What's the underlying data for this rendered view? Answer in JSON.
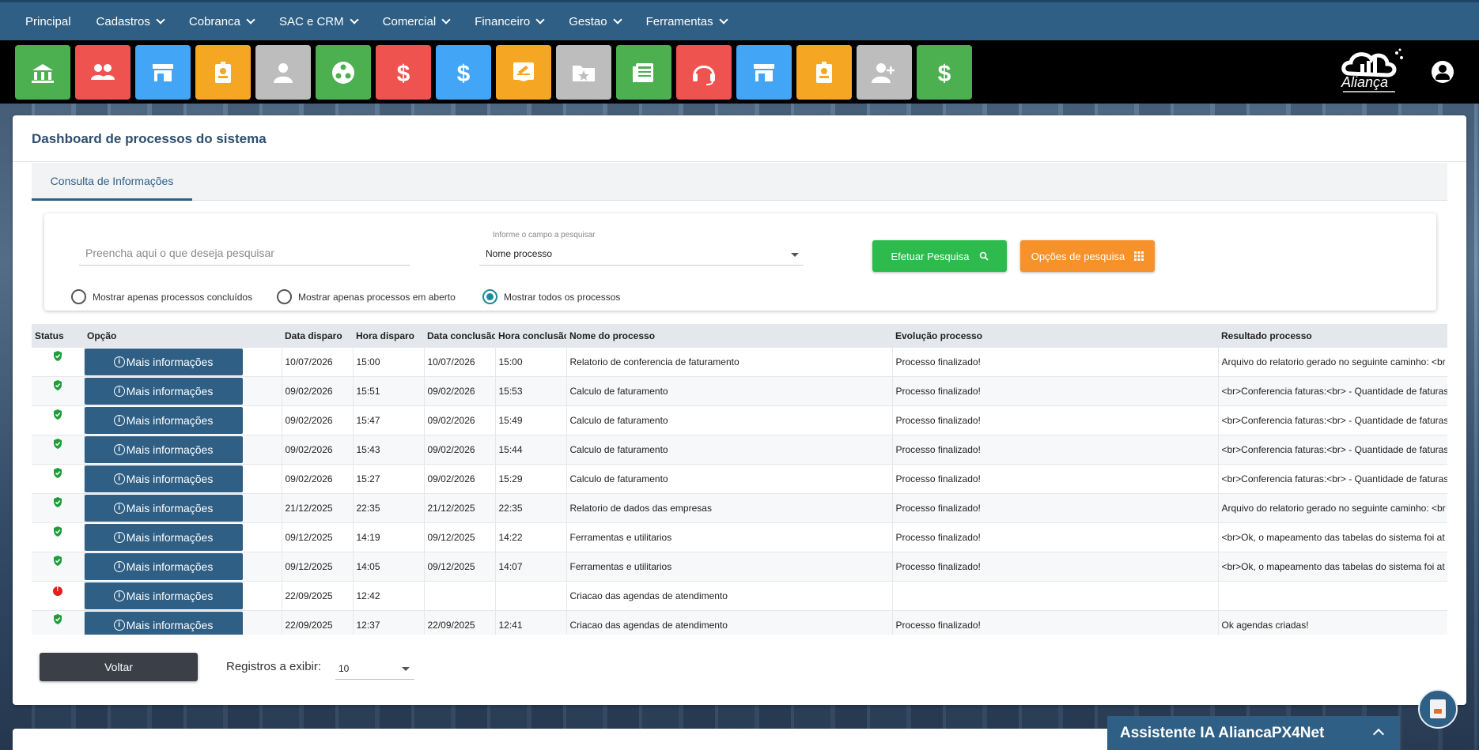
{
  "nav": {
    "items": [
      {
        "label": "Principal",
        "has_dropdown": false
      },
      {
        "label": "Cadastros",
        "has_dropdown": true
      },
      {
        "label": "Cobranca",
        "has_dropdown": true
      },
      {
        "label": "SAC e CRM",
        "has_dropdown": true
      },
      {
        "label": "Comercial",
        "has_dropdown": true
      },
      {
        "label": "Financeiro",
        "has_dropdown": true
      },
      {
        "label": "Gestao",
        "has_dropdown": true
      },
      {
        "label": "Ferramentas",
        "has_dropdown": true
      }
    ]
  },
  "toolbar": {
    "buttons": [
      {
        "icon": "bank-icon",
        "color": "#4caf50"
      },
      {
        "icon": "users-icon",
        "color": "#ef5350"
      },
      {
        "icon": "store-icon",
        "color": "#42a5f5"
      },
      {
        "icon": "badge-icon",
        "color": "#f5a623"
      },
      {
        "icon": "person-icon",
        "color": "#bdbdbd"
      },
      {
        "icon": "network-icon",
        "color": "#4caf50"
      },
      {
        "icon": "dollar-icon",
        "color": "#ef5350"
      },
      {
        "icon": "dollar-icon",
        "color": "#42a5f5"
      },
      {
        "icon": "edit-note-icon",
        "color": "#f5a623"
      },
      {
        "icon": "folder-star-icon",
        "color": "#bdbdbd"
      },
      {
        "icon": "newspaper-icon",
        "color": "#4caf50"
      },
      {
        "icon": "headset-icon",
        "color": "#ef5350"
      },
      {
        "icon": "store-icon",
        "color": "#42a5f5"
      },
      {
        "icon": "badge-icon",
        "color": "#f5a623"
      },
      {
        "icon": "add-user-icon",
        "color": "#bdbdbd"
      },
      {
        "icon": "dollar-icon",
        "color": "#4caf50"
      }
    ],
    "logo_text": "Aliança"
  },
  "page": {
    "title": "Dashboard de processos do sistema",
    "tab": "Consulta de Informações"
  },
  "search": {
    "placeholder": "Preencha aqui o que deseja pesquisar",
    "value": "",
    "field_label": "Informe o campo a pesquisar",
    "field_value": "Nome processo",
    "search_button": "Efetuar Pesquisa",
    "options_button": "Opções de pesquisa",
    "radios": [
      {
        "label": "Mostrar apenas processos concluídos",
        "checked": false
      },
      {
        "label": "Mostrar apenas processos em aberto",
        "checked": false
      },
      {
        "label": "Mostrar todos os processos",
        "checked": true
      }
    ]
  },
  "table": {
    "columns": [
      "Status",
      "Opção",
      "Data disparo",
      "Hora disparo",
      "Data conclusão",
      "Hora conclusão",
      "Nome do processo",
      "Evolução processo",
      "Resultado processo"
    ],
    "button_label": "Mais informações",
    "rows": [
      {
        "status": "ok",
        "data_disparo": "10/07/2026",
        "hora_disparo": "15:00",
        "data_conclusao": "10/07/2026",
        "hora_conclusao": "15:00",
        "nome": "Relatorio de conferencia de faturamento",
        "evolucao": "Processo finalizado!",
        "resultado": "Arquivo do relatorio gerado no seguinte caminho: <br"
      },
      {
        "status": "ok",
        "data_disparo": "09/02/2026",
        "hora_disparo": "15:51",
        "data_conclusao": "09/02/2026",
        "hora_conclusao": "15:53",
        "nome": "Calculo de faturamento",
        "evolucao": "Processo finalizado!",
        "resultado": "<br>Conferencia faturas:<br> - Quantidade de faturas"
      },
      {
        "status": "ok",
        "data_disparo": "09/02/2026",
        "hora_disparo": "15:47",
        "data_conclusao": "09/02/2026",
        "hora_conclusao": "15:49",
        "nome": "Calculo de faturamento",
        "evolucao": "Processo finalizado!",
        "resultado": "<br>Conferencia faturas:<br> - Quantidade de faturas"
      },
      {
        "status": "ok",
        "data_disparo": "09/02/2026",
        "hora_disparo": "15:43",
        "data_conclusao": "09/02/2026",
        "hora_conclusao": "15:44",
        "nome": "Calculo de faturamento",
        "evolucao": "Processo finalizado!",
        "resultado": "<br>Conferencia faturas:<br> - Quantidade de faturas"
      },
      {
        "status": "ok",
        "data_disparo": "09/02/2026",
        "hora_disparo": "15:27",
        "data_conclusao": "09/02/2026",
        "hora_conclusao": "15:29",
        "nome": "Calculo de faturamento",
        "evolucao": "Processo finalizado!",
        "resultado": "<br>Conferencia faturas:<br> - Quantidade de faturas"
      },
      {
        "status": "ok",
        "data_disparo": "21/12/2025",
        "hora_disparo": "22:35",
        "data_conclusao": "21/12/2025",
        "hora_conclusao": "22:35",
        "nome": "Relatorio de dados das empresas",
        "evolucao": "Processo finalizado!",
        "resultado": "Arquivo do relatorio gerado no seguinte caminho: <br"
      },
      {
        "status": "ok",
        "data_disparo": "09/12/2025",
        "hora_disparo": "14:19",
        "data_conclusao": "09/12/2025",
        "hora_conclusao": "14:22",
        "nome": "Ferramentas e utilitarios",
        "evolucao": "Processo finalizado!",
        "resultado": "<br>Ok, o mapeamento das tabelas do sistema foi at"
      },
      {
        "status": "ok",
        "data_disparo": "09/12/2025",
        "hora_disparo": "14:05",
        "data_conclusao": "09/12/2025",
        "hora_conclusao": "14:07",
        "nome": "Ferramentas e utilitarios",
        "evolucao": "Processo finalizado!",
        "resultado": "<br>Ok, o mapeamento das tabelas do sistema foi at"
      },
      {
        "status": "error",
        "data_disparo": "22/09/2025",
        "hora_disparo": "12:42",
        "data_conclusao": "",
        "hora_conclusao": "",
        "nome": "Criacao das agendas de atendimento",
        "evolucao": "",
        "resultado": ""
      },
      {
        "status": "ok",
        "data_disparo": "22/09/2025",
        "hora_disparo": "12:37",
        "data_conclusao": "22/09/2025",
        "hora_conclusao": "12:41",
        "nome": "Criacao das agendas de atendimento",
        "evolucao": "Processo finalizado!",
        "resultado": "Ok agendas criadas!"
      }
    ]
  },
  "footer": {
    "back_button": "Voltar",
    "rows_label": "Registros a exibir:",
    "rows_value": "10"
  },
  "assistant": {
    "title": "Assistente IA AliancaPX4Net"
  }
}
